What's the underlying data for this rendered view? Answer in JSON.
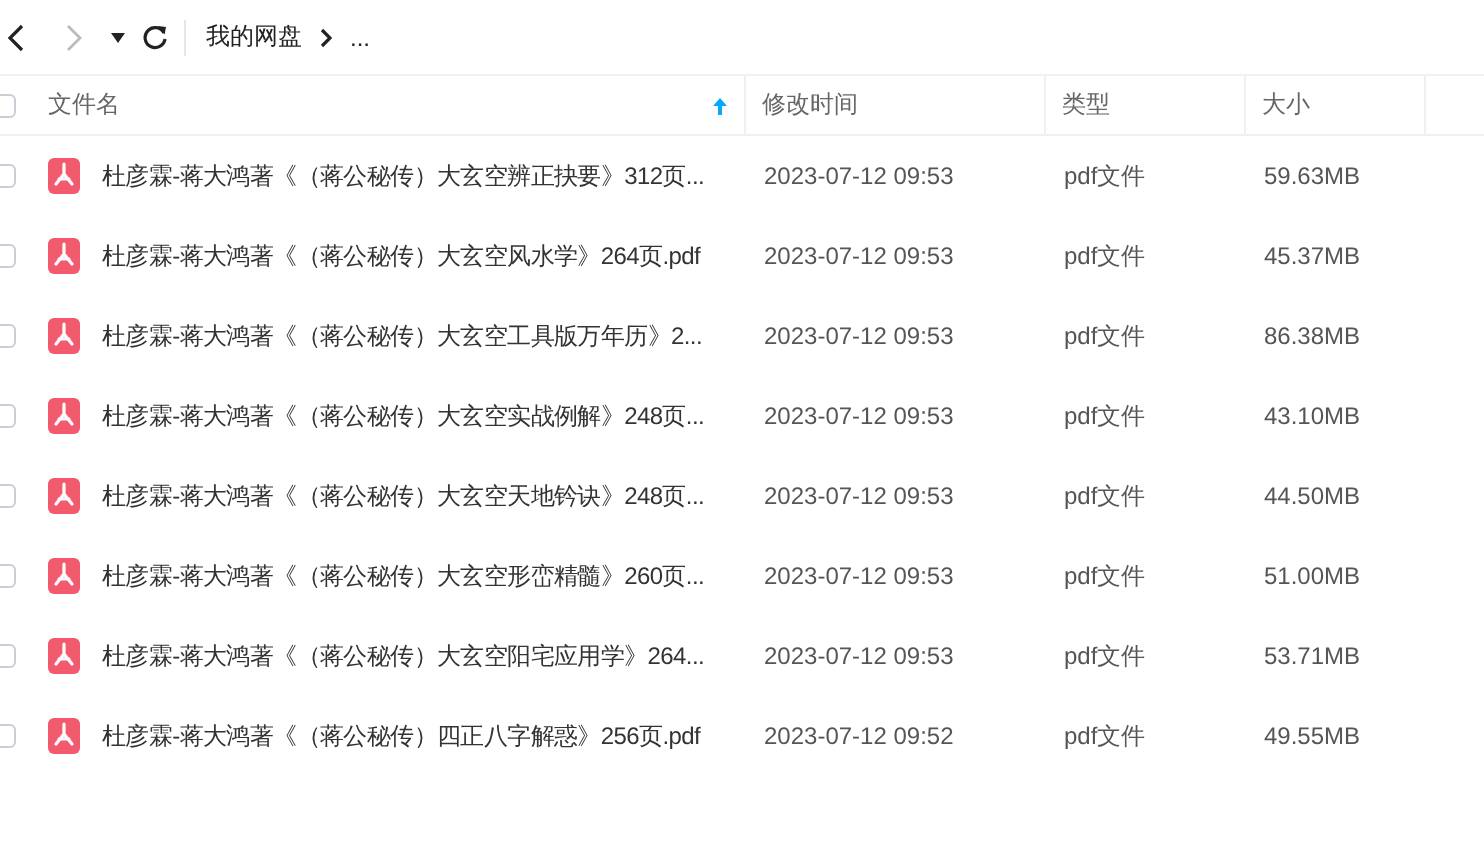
{
  "toolbar": {
    "breadcrumb": [
      "我的网盘",
      "..."
    ]
  },
  "table": {
    "select_all": {
      "checked": false
    },
    "columns": [
      {
        "label": "文件名",
        "sorted": true
      },
      {
        "label": "修改时间",
        "sorted": false
      },
      {
        "label": "类型",
        "sorted": false
      },
      {
        "label": "大小",
        "sorted": false
      }
    ],
    "rows": [
      {
        "checked": false,
        "name": "杜彦霖-蒋大鸿著《（蒋公秘传）大玄空辨正抉要》312页...",
        "modified": "2023-07-12 09:53",
        "type": "pdf文件",
        "size": "59.63MB"
      },
      {
        "checked": false,
        "name": "杜彦霖-蒋大鸿著《（蒋公秘传）大玄空风水学》264页.pdf",
        "modified": "2023-07-12 09:53",
        "type": "pdf文件",
        "size": "45.37MB"
      },
      {
        "checked": false,
        "name": "杜彦霖-蒋大鸿著《（蒋公秘传）大玄空工具版万年历》2...",
        "modified": "2023-07-12 09:53",
        "type": "pdf文件",
        "size": "86.38MB"
      },
      {
        "checked": false,
        "name": "杜彦霖-蒋大鸿著《（蒋公秘传）大玄空实战例解》248页...",
        "modified": "2023-07-12 09:53",
        "type": "pdf文件",
        "size": "43.10MB"
      },
      {
        "checked": false,
        "name": "杜彦霖-蒋大鸿著《（蒋公秘传）大玄空天地钤诀》248页...",
        "modified": "2023-07-12 09:53",
        "type": "pdf文件",
        "size": "44.50MB"
      },
      {
        "checked": false,
        "name": "杜彦霖-蒋大鸿著《（蒋公秘传）大玄空形峦精髓》260页...",
        "modified": "2023-07-12 09:53",
        "type": "pdf文件",
        "size": "51.00MB"
      },
      {
        "checked": false,
        "name": "杜彦霖-蒋大鸿著《（蒋公秘传）大玄空阳宅应用学》264...",
        "modified": "2023-07-12 09:53",
        "type": "pdf文件",
        "size": "53.71MB"
      },
      {
        "checked": false,
        "name": "杜彦霖-蒋大鸿著《（蒋公秘传）四正八字解惑》256页.pdf",
        "modified": "2023-07-12 09:52",
        "type": "pdf文件",
        "size": "49.55MB"
      }
    ]
  }
}
